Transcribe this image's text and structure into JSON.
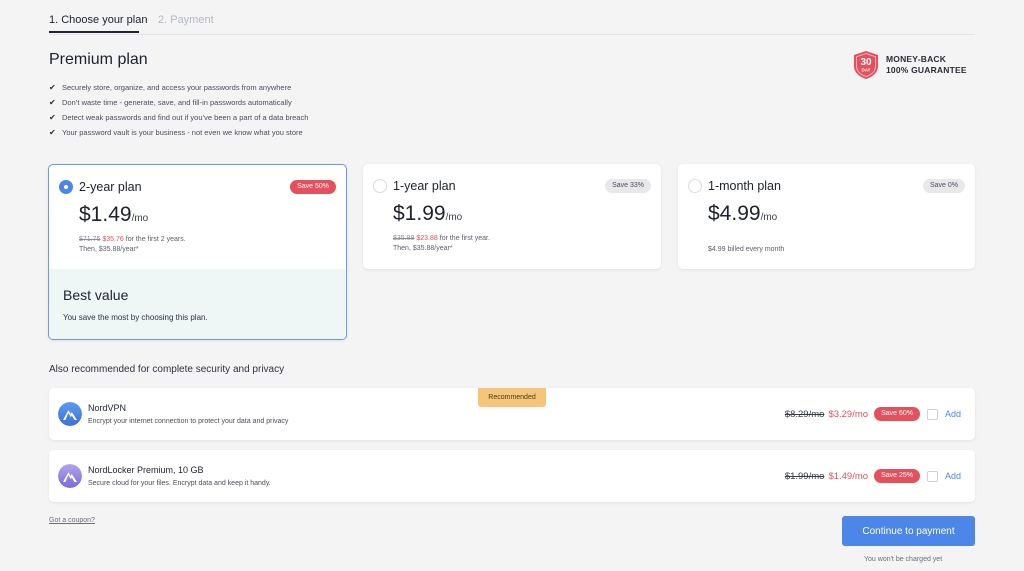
{
  "steps": [
    {
      "label": "1. Choose your plan",
      "active": true
    },
    {
      "label": "2. Payment",
      "active": false
    }
  ],
  "header": {
    "title": "Premium plan",
    "features": [
      "Securely store, organize, and access your passwords from anywhere",
      "Don’t waste time - generate, save, and fill-in passwords automatically",
      "Detect weak passwords and find out if you’ve been a part of a data breach",
      "Your password vault is your business - not even we know what you store"
    ]
  },
  "guarantee": {
    "badge_number": "30",
    "badge_unit": "DAY",
    "line1": "MONEY-BACK",
    "line2": "100% GUARANTEE"
  },
  "plans": [
    {
      "name": "2-year plan",
      "save": "Save 50%",
      "price": "$1.49",
      "per": "/mo",
      "old": "$71.76",
      "new": "$35.76",
      "note1": "for the first 2 years.",
      "note2": "Then, $35.88/year*",
      "best_title": "Best value",
      "best_sub": "You save the most by choosing this plan."
    },
    {
      "name": "1-year plan",
      "save": "Save 33%",
      "price": "$1.99",
      "per": "/mo",
      "old": "$35.88",
      "new": "$23.88",
      "note1": "for the first year.",
      "note2": "Then, $35.88/year*"
    },
    {
      "name": "1-month plan",
      "save": "Save 0%",
      "price": "$4.99",
      "per": "/mo",
      "note1": "$4.99 billed every month"
    }
  ],
  "recommended": {
    "heading": "Also recommended for complete security and privacy",
    "ribbon": "Recommended",
    "items": [
      {
        "name": "NordVPN",
        "desc": "Encrypt your internet connection to protect your data and privacy",
        "old": "$8.29/mo",
        "new": "$3.29/mo",
        "save": "Save 60%",
        "add": "Add"
      },
      {
        "name": "NordLocker Premium, 10 GB",
        "desc": "Secure cloud for your files. Encrypt data and keep it handy.",
        "old": "$1.99/mo",
        "new": "$1.49/mo",
        "save": "Save 25%",
        "add": "Add"
      }
    ]
  },
  "footer": {
    "coupon": "Got a coupon?",
    "continue": "Continue to payment",
    "no_charge": "You won't be charged yet"
  },
  "colors": {
    "accent": "#4b86e8",
    "sale": "#e5505c",
    "ribbon": "#f5c579",
    "best_bg": "#eef6f6"
  }
}
